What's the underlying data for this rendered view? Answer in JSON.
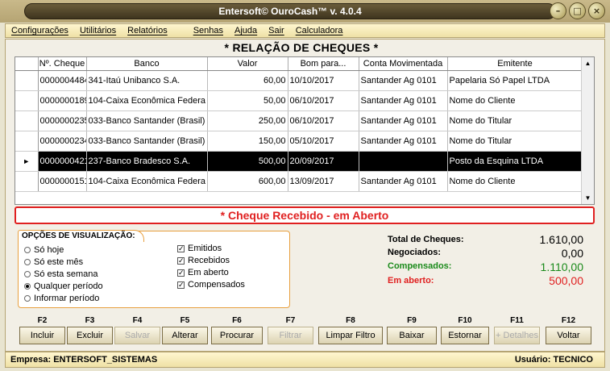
{
  "window": {
    "title": "Entersoft© OuroCash™ v. 4.0.4"
  },
  "menu": [
    "Configurações",
    "Utilitários",
    "Relatórios",
    "Senhas",
    "Ajuda",
    "Sair",
    "Calculadora"
  ],
  "section_title": "* RELAÇÃO DE CHEQUES *",
  "table": {
    "columns": [
      "Nº. Cheque",
      "Banco",
      "Valor",
      "Bom para...",
      "Conta Movimentada",
      "Emitente"
    ],
    "rows": [
      {
        "cheque": "0000004484",
        "banco": "341-Itaú Unibanco S.A.",
        "valor": "60,00",
        "bom_para": "10/10/2017",
        "conta": "Santander Ag 0101",
        "emitente": "Papelaria Só Papel LTDA"
      },
      {
        "cheque": "0000000189",
        "banco": "104-Caixa Econômica Federa",
        "valor": "50,00",
        "bom_para": "06/10/2017",
        "conta": "Santander Ag 0101",
        "emitente": "Nome do Cliente"
      },
      {
        "cheque": "0000000235",
        "banco": "033-Banco Santander (Brasil)",
        "valor": "250,00",
        "bom_para": "06/10/2017",
        "conta": "Santander Ag 0101",
        "emitente": "Nome do Titular"
      },
      {
        "cheque": "0000000234",
        "banco": "033-Banco Santander (Brasil)",
        "valor": "150,00",
        "bom_para": "05/10/2017",
        "conta": "Santander Ag 0101",
        "emitente": "Nome do Titular"
      },
      {
        "cheque": "0000000421",
        "banco": "237-Banco Bradesco S.A.",
        "valor": "500,00",
        "bom_para": "20/09/2017",
        "conta": "",
        "emitente": "Posto da Esquina LTDA"
      },
      {
        "cheque": "0000000151",
        "banco": "104-Caixa Econômica Federa",
        "valor": "600,00",
        "bom_para": "13/09/2017",
        "conta": "Santander Ag 0101",
        "emitente": "Nome do Cliente"
      }
    ],
    "selected_row_indicator": "►"
  },
  "status_text": "* Cheque Recebido - em Aberto",
  "options": {
    "title": "OPÇÕES DE VISUALIZAÇÃO:",
    "radios": [
      "Só hoje",
      "Só este mês",
      "Só esta semana",
      "Qualquer período",
      "Informar período"
    ],
    "selected_radio": 3,
    "checks": [
      "Emitidos",
      "Recebidos",
      "Em aberto",
      "Compensados"
    ],
    "check_mark": "✓"
  },
  "totals": {
    "total_label": "Total de Cheques:",
    "total_value": "1.610,00",
    "neg_label": "Negociados:",
    "neg_value": "0,00",
    "comp_label": "Compensados:",
    "comp_value": "1.110,00",
    "aberto_label": "Em aberto:",
    "aberto_value": "500,00",
    "colors": {
      "comp": "#1a8a1a",
      "aberto": "#e02020"
    }
  },
  "fkeys": [
    {
      "key": "F2",
      "label": "Incluir",
      "enabled": true
    },
    {
      "key": "F3",
      "label": "Excluir",
      "enabled": true
    },
    {
      "key": "F4",
      "label": "Salvar",
      "enabled": false
    },
    {
      "key": "F5",
      "label": "Alterar",
      "enabled": true
    },
    {
      "key": "F6",
      "label": "Procurar",
      "enabled": true
    },
    {
      "key": "F7",
      "label": "Filtrar",
      "enabled": false
    },
    {
      "key": "F8",
      "label": "Limpar Filtro",
      "enabled": true
    },
    {
      "key": "F9",
      "label": "Baixar",
      "enabled": true
    },
    {
      "key": "F10",
      "label": "Estornar",
      "enabled": true
    },
    {
      "key": "F11",
      "label": "+ Detalhes",
      "enabled": false
    },
    {
      "key": "F12",
      "label": "Voltar",
      "enabled": true
    }
  ],
  "footer": {
    "empresa": "Empresa: ENTERSOFT_SISTEMAS",
    "usuario": "Usuário: TECNICO"
  }
}
